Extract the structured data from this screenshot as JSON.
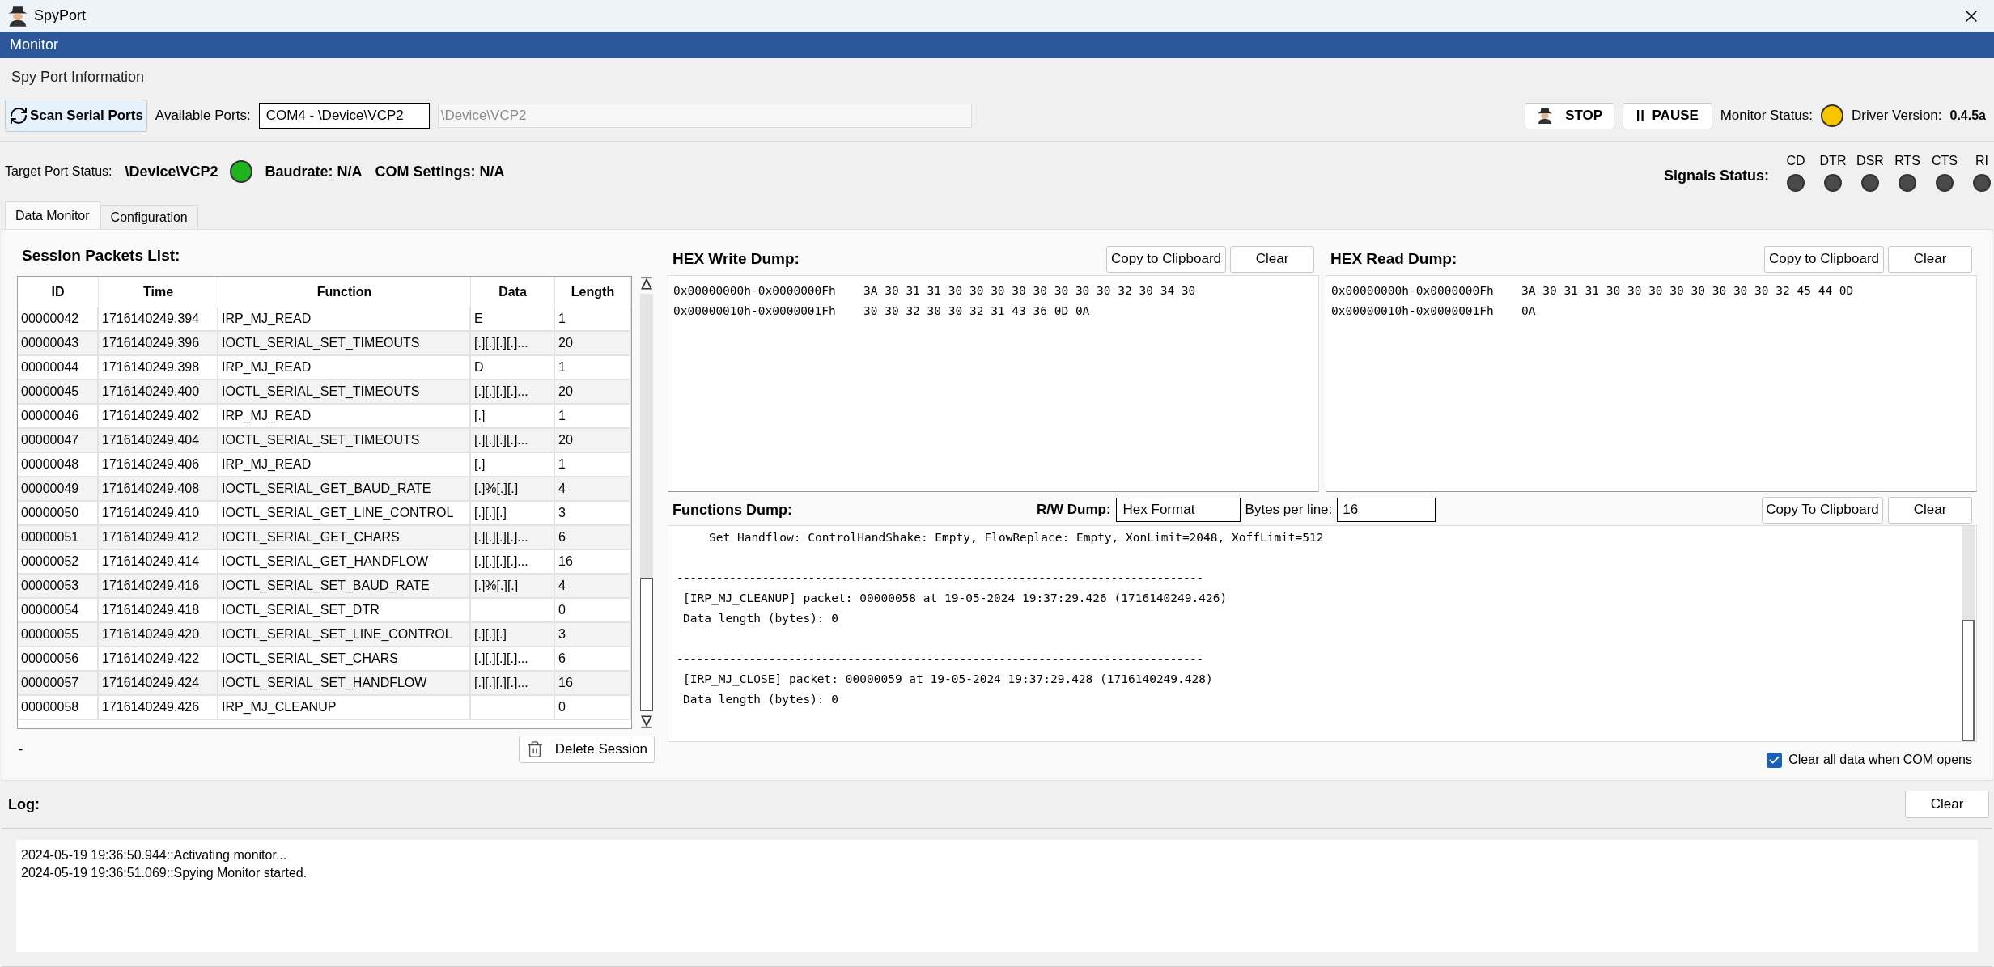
{
  "window": {
    "title": "SpyPort"
  },
  "menu": [
    {
      "label": "Monitor",
      "selected": true
    }
  ],
  "spy_port_info": {
    "title": "Spy Port Information",
    "scan_button": "Scan Serial Ports",
    "available_ports_label": "Available Ports:",
    "available_ports_value": "COM4 - \\Device\\VCP2",
    "device_path": "\\Device\\VCP2",
    "stop_button": "STOP",
    "pause_button": "PAUSE",
    "monitor_status_label": "Monitor Status:",
    "monitor_active": true,
    "driver_version_label": "Driver Version:",
    "driver_version": "0.4.5a"
  },
  "target_port": {
    "label": "Target Port Status:",
    "port": "\\Device\\VCP2",
    "connected": true,
    "baudrate": "Baudrate: N/A",
    "com_settings": "COM Settings: N/A"
  },
  "signals": {
    "label": "Signals Status:",
    "items": [
      {
        "name": "CD",
        "on": false
      },
      {
        "name": "DTR",
        "on": false
      },
      {
        "name": "DSR",
        "on": false
      },
      {
        "name": "RTS",
        "on": false
      },
      {
        "name": "CTS",
        "on": false
      },
      {
        "name": "RI",
        "on": false
      }
    ]
  },
  "tabs": [
    {
      "label": "Data Monitor",
      "selected": true
    },
    {
      "label": "Configuration",
      "selected": false
    }
  ],
  "session": {
    "title": "Session Packets List:",
    "columns": [
      "ID",
      "Time",
      "Function",
      "Data",
      "Length"
    ],
    "rows": [
      [
        "00000042",
        "1716140249.394",
        "IRP_MJ_READ",
        "E",
        "1"
      ],
      [
        "00000043",
        "1716140249.396",
        "IOCTL_SERIAL_SET_TIMEOUTS",
        "[.][.][.][.]...",
        "20"
      ],
      [
        "00000044",
        "1716140249.398",
        "IRP_MJ_READ",
        "D",
        "1"
      ],
      [
        "00000045",
        "1716140249.400",
        "IOCTL_SERIAL_SET_TIMEOUTS",
        "[.][.][.][.]...",
        "20"
      ],
      [
        "00000046",
        "1716140249.402",
        "IRP_MJ_READ",
        "[.]",
        "1"
      ],
      [
        "00000047",
        "1716140249.404",
        "IOCTL_SERIAL_SET_TIMEOUTS",
        "[.][.][.][.]...",
        "20"
      ],
      [
        "00000048",
        "1716140249.406",
        "IRP_MJ_READ",
        "[.]",
        "1"
      ],
      [
        "00000049",
        "1716140249.408",
        "IOCTL_SERIAL_GET_BAUD_RATE",
        "[.]%[.][.]",
        "4"
      ],
      [
        "00000050",
        "1716140249.410",
        "IOCTL_SERIAL_GET_LINE_CONTROL",
        "[.][.][.]",
        "3"
      ],
      [
        "00000051",
        "1716140249.412",
        "IOCTL_SERIAL_GET_CHARS",
        "[.][.][.][.]...",
        "6"
      ],
      [
        "00000052",
        "1716140249.414",
        "IOCTL_SERIAL_GET_HANDFLOW",
        "[.][.][.][.]...",
        "16"
      ],
      [
        "00000053",
        "1716140249.416",
        "IOCTL_SERIAL_SET_BAUD_RATE",
        "[.]%[.][.]",
        "4"
      ],
      [
        "00000054",
        "1716140249.418",
        "IOCTL_SERIAL_SET_DTR",
        null,
        "0"
      ],
      [
        "00000055",
        "1716140249.420",
        "IOCTL_SERIAL_SET_LINE_CONTROL",
        "[.][.][.]",
        "3"
      ],
      [
        "00000056",
        "1716140249.422",
        "IOCTL_SERIAL_SET_CHARS",
        "[.][.][.][.]...",
        "6"
      ],
      [
        "00000057",
        "1716140249.424",
        "IOCTL_SERIAL_SET_HANDFLOW",
        "[.][.][.][.]...",
        "16"
      ],
      [
        "00000058",
        "1716140249.426",
        "IRP_MJ_CLEANUP",
        null,
        "0"
      ]
    ],
    "status": "-",
    "delete_button": "Delete Session"
  },
  "hex_dumps": [
    {
      "title": "HEX Write Dump:",
      "copy_button": "Copy to Clipboard",
      "clear_button": "Clear",
      "lines": [
        {
          "address": "0x00000000h-0x0000000Fh",
          "bytes": "3A 30 31 31 30 30 30 30 30 30 30 30 32 30 34 30"
        },
        {
          "address": "0x00000010h-0x0000001Fh",
          "bytes": "30 30 32 30 30 32 31 43 36 0D 0A"
        }
      ]
    },
    {
      "title": "HEX Read Dump:",
      "copy_button": "Copy to Clipboard",
      "clear_button": "Clear",
      "lines": [
        {
          "address": "0x00000000h-0x0000000Fh",
          "bytes": "3A 30 31 31 30 30 30 30 30 30 30 30 32 45 44 0D"
        },
        {
          "address": "0x00000010h-0x0000001Fh",
          "bytes": "0A"
        }
      ]
    }
  ],
  "functions_dump": {
    "title": "Functions Dump:",
    "rw_label": "R/W Dump:",
    "rw_value": "Hex Format",
    "bytes_label": "Bytes per line:",
    "bytes_value": "16",
    "copy_button": "Copy To Clipboard",
    "clear_button": "Clear",
    "lines": [
      {
        "kind": "setting",
        "text": "Set Handflow: ControlHandShake: Empty, FlowReplace: Empty, XonLimit=2048, XoffLimit=512"
      },
      {
        "kind": "separator",
        "text": "--------------------------------------------------------------------------------"
      },
      {
        "kind": "header",
        "text": "[IRP_MJ_CLEANUP] packet: 00000058 at 19-05-2024 19:37:29.426 (1716140249.426)"
      },
      {
        "kind": "detail",
        "text": "Data length (bytes): 0"
      },
      {
        "kind": "separator",
        "text": "--------------------------------------------------------------------------------"
      },
      {
        "kind": "header",
        "text": "[IRP_MJ_CLOSE] packet: 00000059 at 19-05-2024 19:37:29.428 (1716140249.428)"
      },
      {
        "kind": "detail",
        "text": "Data length (bytes): 0"
      }
    ]
  },
  "clear_on_open": {
    "label": "Clear all data when COM opens",
    "checked": true
  },
  "log": {
    "title": "Log:",
    "clear_button": "Clear",
    "lines": [
      "2024-05-19 19:36:50.944::Activating monitor...",
      "2024-05-19 19:36:51.069::Spying Monitor started."
    ]
  }
}
